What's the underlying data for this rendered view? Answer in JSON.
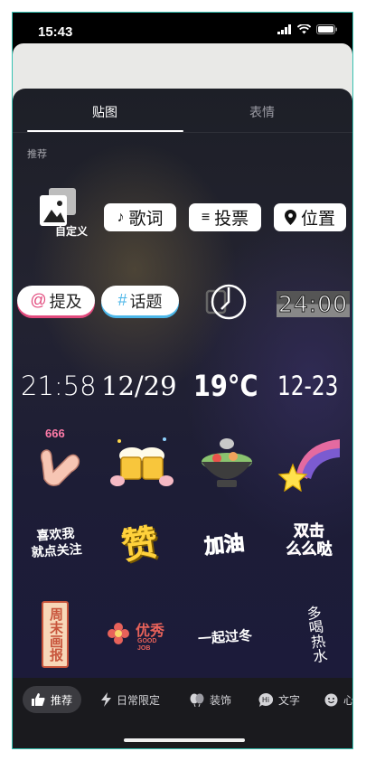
{
  "status": {
    "time": "15:43"
  },
  "tabs": {
    "stickers": "贴图",
    "emoji": "表情"
  },
  "section": {
    "recommended": "推荐"
  },
  "tools": {
    "custom": "自定义",
    "lyrics": "歌词",
    "vote": "投票",
    "location": "位置",
    "mention_symbol": "@",
    "mention": "提及",
    "topic_symbol": "#",
    "topic": "话题"
  },
  "widgets": {
    "flip_clock": "24:00",
    "time": "21:58",
    "date": "12/29",
    "weather": "19°C",
    "date2": "12-23"
  },
  "stickers": {
    "num666": "666",
    "follow": "喜欢我\n就点关注",
    "like": "赞",
    "cheer": "加油",
    "double_tap": "双击\n么么哒",
    "weekend": "周末画报",
    "excellent": "优秀",
    "good_job": "GOOD JOB",
    "together": "一起过冬",
    "drink_water": "多喝热水"
  },
  "categories": {
    "recommended": "推荐",
    "daily": "日常限定",
    "decor": "装饰",
    "text": "文字",
    "mood": "心"
  },
  "colors": {
    "accent_pink": "#e24a7d",
    "accent_blue": "#4bb6e8",
    "sheet_bg": "#1f1f30"
  }
}
